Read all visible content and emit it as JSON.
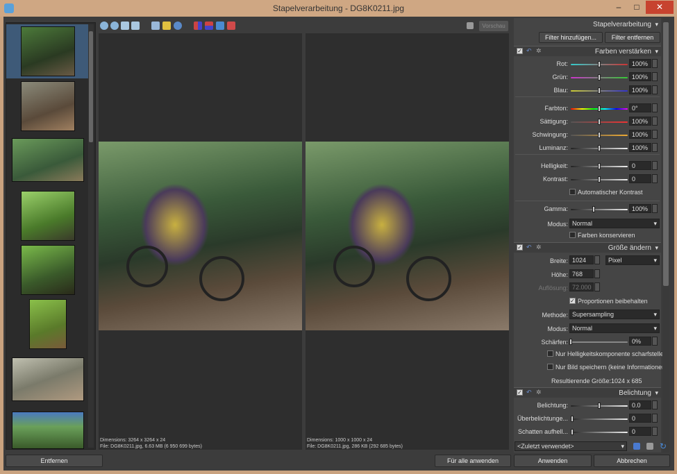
{
  "window": {
    "title": "Stapelverarbeitung - DG8K0211.jpg",
    "minimize": "–",
    "maximize": "□",
    "close": "✕"
  },
  "toolbar": {
    "preview_label": "Vorschau"
  },
  "panes": {
    "left": {
      "dimensions": "Dimensions: 3264 x 3264 x 24",
      "file": "File: DG8K0211.jpg, 6.63 MB (6 950 699 bytes)"
    },
    "right": {
      "dimensions": "Dimensions: 1000 x 1000 x 24",
      "file": "File: DG8K0211.jpg, 286 KB (292 685 bytes)"
    }
  },
  "panel": {
    "header": "Stapelverarbeitung",
    "add_filter": "Filter hinzufügen...",
    "remove_filter": "Filter entfernen",
    "section_color": {
      "title": "Farben verstärken",
      "rows": [
        {
          "label": "Rot:",
          "value": "100%",
          "level": 0.5,
          "gradient": "#3cc 0%,#c33 100%"
        },
        {
          "label": "Grün:",
          "value": "100%",
          "level": 0.5,
          "gradient": "#c3c 0%,#3c3 100%"
        },
        {
          "label": "Blau:",
          "value": "100%",
          "level": 0.5,
          "gradient": "#cc3 0%,#33c 100%"
        },
        {
          "label": "Farbton:",
          "value": "0°",
          "level": 0.5,
          "gradient": "#f00 0%,#ff0 20%,#0f0 40%,#0ff 60%,#00f 80%,#f0f 100%"
        },
        {
          "label": "Sättigung:",
          "value": "100%",
          "level": 0.5,
          "gradient": "#555 0%,#e33 100%"
        },
        {
          "label": "Schwingung:",
          "value": "100%",
          "level": 0.5,
          "gradient": "#555 0%,#ea3 100%"
        },
        {
          "label": "Luminanz:",
          "value": "100%",
          "level": 0.5,
          "gradient": "#222 0%,#eee 100%"
        },
        {
          "label": "Helligkeit:",
          "value": "0",
          "level": 0.5,
          "gradient": "#222 0%,#eee 100%"
        },
        {
          "label": "Kontrast:",
          "value": "0",
          "level": 0.5,
          "gradient": "#222 0%,#eee 100%"
        }
      ],
      "auto_contrast": "Automatischer Kontrast",
      "gamma": {
        "label": "Gamma:",
        "value": "100%",
        "level": 0.4
      },
      "mode_label": "Modus:",
      "mode_value": "Normal",
      "keep_colors": "Farben konservieren"
    },
    "section_resize": {
      "title": "Größe ändern",
      "width_label": "Breite:",
      "width_value": "1024",
      "unit": "Pixel",
      "height_label": "Höhe:",
      "height_value": "768",
      "res_label": "Auflösung:",
      "res_value": "72.000",
      "keep_ratio": "Proportionen beibehalten",
      "method_label": "Methode:",
      "method_value": "Supersampling",
      "mode_label": "Modus:",
      "mode_value": "Normal",
      "sharpen_label": "Schärfen:",
      "sharpen_value": "0%",
      "luma_only": "Nur Helligkeitskomponente scharfstelle",
      "image_only": "Nur Bild speichern (keine Informationen",
      "result_label": "Resultierende Größe:",
      "result_value": "1024 x 685"
    },
    "section_exposure": {
      "title": "Belichtung",
      "rows": [
        {
          "label": "Belichtung:",
          "value": "0.0",
          "level": 0.5
        },
        {
          "label": "Überbelichtunge...",
          "value": "0",
          "level": 0.0
        },
        {
          "label": "Schatten aufhell...",
          "value": "0",
          "level": 0.0
        }
      ]
    },
    "recent": "<Zuletzt verwendet>"
  },
  "buttons": {
    "remove": "Entfernen",
    "apply_all": "Für alle anwenden",
    "apply": "Anwenden",
    "cancel": "Abbrechen"
  }
}
